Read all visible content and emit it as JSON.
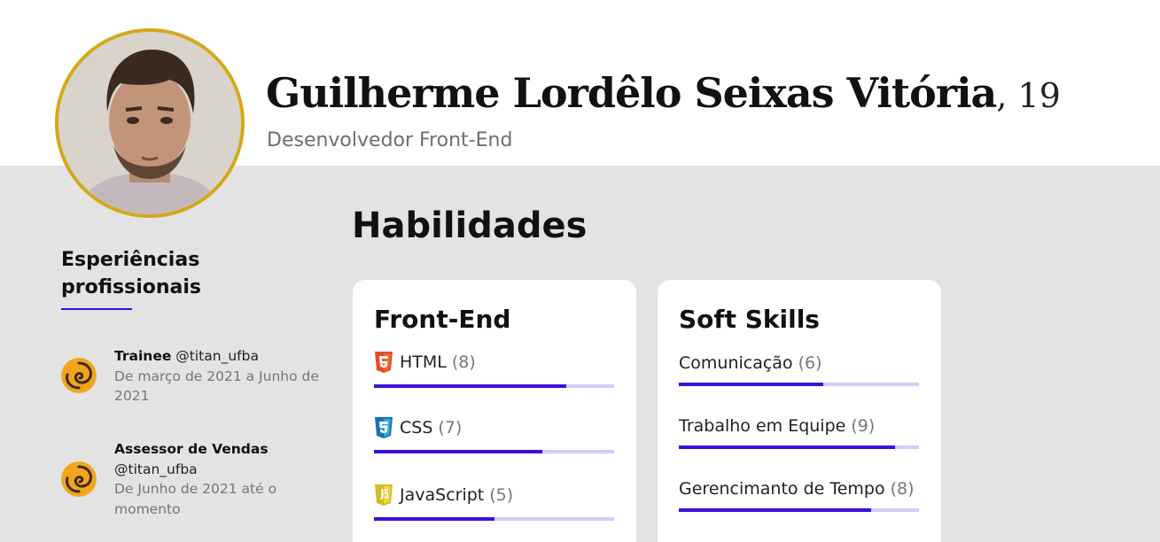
{
  "profile": {
    "name": "Guilherme Lordêlo Seixas Vitória",
    "age": ", 19",
    "role": "Desenvolvedor Front-End",
    "avatar_border_color": "#d4a818"
  },
  "experience": {
    "title": "Esperiências profissionais",
    "accent_color": "#3d0de0",
    "items": [
      {
        "role": "Trainee",
        "handle": "@titan_ufba",
        "period": "De março de 2021 a Junho de 2021",
        "logo_icon": "titan-logo-icon"
      },
      {
        "role": "Assessor de Vendas",
        "handle": "@titan_ufba",
        "period": "De Junho de 2021 até o momento",
        "logo_icon": "titan-logo-icon"
      }
    ]
  },
  "skills": {
    "title": "Habilidades",
    "bar_color": "#3d0de0",
    "bar_track_color": "#d4ccf7",
    "max_level": 10,
    "cards": [
      {
        "title": "Front-End",
        "items": [
          {
            "name": "HTML",
            "level": "(8)",
            "value": 8,
            "icon": "html5-icon"
          },
          {
            "name": "CSS",
            "level": "(7)",
            "value": 7,
            "icon": "css3-icon"
          },
          {
            "name": "JavaScript",
            "level": "(5)",
            "value": 5,
            "icon": "javascript-icon"
          }
        ]
      },
      {
        "title": "Soft Skills",
        "items": [
          {
            "name": "Comunicação",
            "level": "(6)",
            "value": 6
          },
          {
            "name": "Trabalho em Equipe",
            "level": "(9)",
            "value": 9
          },
          {
            "name": "Gerencimanto de Tempo",
            "level": "(8)",
            "value": 8
          }
        ]
      }
    ]
  }
}
